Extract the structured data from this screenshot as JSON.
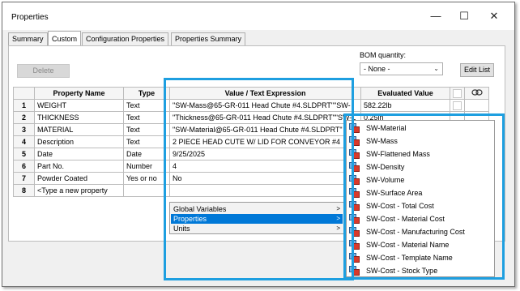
{
  "window": {
    "title": "Properties",
    "minimize": "—",
    "maximize": "☐",
    "close": "✕"
  },
  "tabs": [
    {
      "label": "Summary",
      "active": false
    },
    {
      "label": "Custom",
      "active": true
    },
    {
      "label": "Configuration Properties",
      "active": false
    },
    {
      "label": "Properties Summary",
      "active": false
    }
  ],
  "toolbar": {
    "delete_label": "Delete",
    "bom_label": "BOM quantity:",
    "bom_value": "- None -",
    "edit_list_label": "Edit List"
  },
  "table": {
    "headers": {
      "property_name": "Property Name",
      "type": "Type",
      "value": "Value / Text Expression",
      "evaluated": "Evaluated Value"
    },
    "rows": [
      {
        "num": "1",
        "name": "WEIGHT",
        "type": "Text",
        "value": "\"SW-Mass@65-GR-011 Head Chute #4.SLDPRT\"\"SW-",
        "evaluated": "582.22lb"
      },
      {
        "num": "2",
        "name": "THICKNESS",
        "type": "Text",
        "value": "\"Thickness@65-GR-011 Head Chute #4.SLDPRT\"\"SW-L",
        "evaluated": "0.25in"
      },
      {
        "num": "3",
        "name": "MATERIAL",
        "type": "Text",
        "value": "\"SW-Material@65-GR-011 Head Chute #4.SLDPRT\"",
        "evaluated": ""
      },
      {
        "num": "4",
        "name": "Description",
        "type": "Text",
        "value": "2 PIECE HEAD CUTE W/ LID FOR CONVEYOR #4",
        "evaluated": ""
      },
      {
        "num": "5",
        "name": "Date",
        "type": "Date",
        "value": "9/25/2025",
        "evaluated": ""
      },
      {
        "num": "6",
        "name": "Part No.",
        "type": "Number",
        "value": "4",
        "evaluated": ""
      },
      {
        "num": "7",
        "name": "Powder Coated",
        "type": "Yes or no",
        "value": "No",
        "evaluated": ""
      },
      {
        "num": "8",
        "name": "<Type a new property",
        "type": "",
        "value": "",
        "evaluated": ""
      }
    ]
  },
  "context_menu": {
    "items": [
      {
        "label": "Global Variables",
        "arrow": ">"
      },
      {
        "label": "Properties",
        "arrow": ">"
      },
      {
        "label": "Units",
        "arrow": ">"
      }
    ]
  },
  "submenu": {
    "items": [
      "SW-Material",
      "SW-Mass",
      "SW-Flattened Mass",
      "SW-Density",
      "SW-Volume",
      "SW-Surface Area",
      "SW-Cost - Total Cost",
      "SW-Cost - Material Cost",
      "SW-Cost - Manufacturing Cost",
      "SW-Cost - Material Name",
      "SW-Cost - Template Name",
      "SW-Cost - Stock Type"
    ]
  },
  "colors": {
    "highlight": "#1e9fe0",
    "selection": "#0078d7"
  }
}
